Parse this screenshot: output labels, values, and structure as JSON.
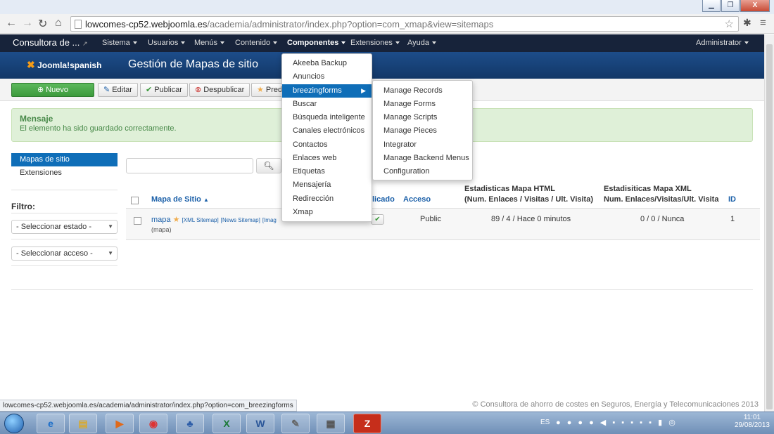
{
  "window": {
    "minimize_icon": "minimize-icon",
    "restore_icon": "restore-icon",
    "close_label": "X"
  },
  "browser": {
    "url_host": "lowcomes-cp52.webjoomla.es",
    "url_path": "/academia/administrator/index.php?option=com_xmap&view=sitemaps"
  },
  "navbar": {
    "brand": "Consultora de ...",
    "items": [
      "Sistema",
      "Usuarios",
      "Menús",
      "Contenido",
      "Componentes",
      "Extensiones",
      "Ayuda"
    ],
    "user": "Administrator"
  },
  "header": {
    "logo_text": "Joomla!",
    "logo_suffix": "spanish",
    "title": "Gestión de Mapas de sitio"
  },
  "toolbar": {
    "new": "Nuevo",
    "edit": "Editar",
    "publish": "Publicar",
    "unpublish": "Despublicar",
    "default": "Pred"
  },
  "message": {
    "title": "Mensaje",
    "text": "El elemento ha sido guardado correctamente."
  },
  "sidebar": {
    "items": [
      "Mapas de sitio",
      "Extensiones"
    ],
    "filter_label": "Filtro:",
    "select_state": "- Seleccionar estado -",
    "select_access": "- Seleccionar acceso -"
  },
  "table": {
    "headers": {
      "title": "Mapa de Sitio",
      "published": "licado",
      "access": "Acceso",
      "html_stats_1": "Estadisticas Mapa HTML",
      "html_stats_2": "(Num. Enlaces / Visitas / Ult. Visita)",
      "xml_stats_1": "Estadisiticas Mapa XML",
      "xml_stats_2": "Num. Enlaces/Visitas/Ult. Visita",
      "id": "ID"
    },
    "rows": [
      {
        "title": "mapa",
        "links": [
          "[XML Sitemap]",
          "[News Sitemap]",
          "[Imag"
        ],
        "alias": "(mapa)",
        "access": "Public",
        "html_stats": "89 / 4 / Hace 0 minutos",
        "xml_stats": "0 / 0 / Nunca",
        "id": "1"
      }
    ]
  },
  "components_menu": {
    "items": [
      "Akeeba Backup",
      "Anuncios",
      "breezingforms",
      "Buscar",
      "Búsqueda inteligente",
      "Canales electrónicos",
      "Contactos",
      "Enlaces web",
      "Etiquetas",
      "Mensajería",
      "Redirección",
      "Xmap"
    ]
  },
  "breezingforms_menu": {
    "items": [
      "Manage Records",
      "Manage Forms",
      "Manage Scripts",
      "Manage Pieces",
      "Integrator",
      "Manage Backend Menus",
      "Configuration"
    ]
  },
  "footer": {
    "copyright": "© Consultora de ahorro de costes en Seguros, Energía y Telecomunicaciones 2013"
  },
  "statusbar": {
    "url": "lowcomes-cp52.webjoomla.es/academia/administrator/index.php?option=com_breezingforms"
  },
  "taskbar": {
    "lang": "ES",
    "time": "11:01",
    "date": "29/08/2013",
    "filezilla": "Z"
  },
  "colors": {
    "navbar": "#17233a",
    "header": "#1d4d8a",
    "menu_highlight": "#0f6eb8",
    "success": "#dff0d8"
  }
}
